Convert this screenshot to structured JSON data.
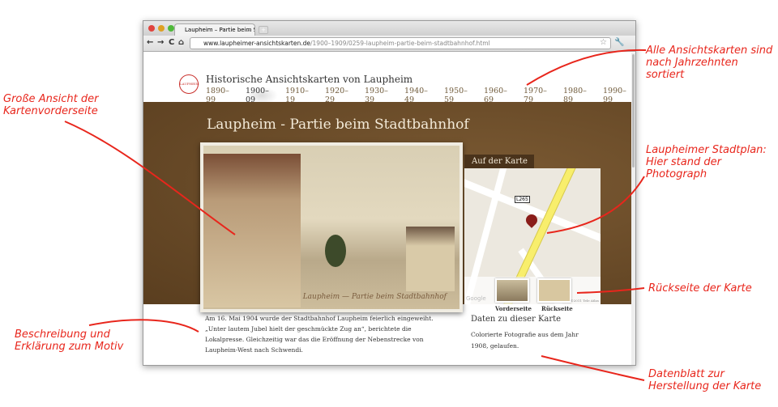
{
  "browser": {
    "tab_title": "Laupheim – Partie beim Stadt",
    "url_domain": "www.laupheimer-ansichtskarten.de",
    "url_path": "/1900–1909/0259-laupheim-partie-beim-stadtbahnhof.html"
  },
  "site": {
    "title": "Historische Ansichtskarten von Laupheim",
    "decades": [
      "1890–99",
      "1900–09",
      "1910–19",
      "1920–29",
      "1930–39",
      "1940–49",
      "1950–59",
      "1960–69",
      "1970–79",
      "1980–89",
      "1990–99"
    ],
    "active_decade": "1900–09"
  },
  "page": {
    "title": "Laupheim - Partie beim Stadtbahnhof",
    "card_caption": "Laupheim — Partie beim Stadtbahnhof",
    "map_tab": "Auf der Karte",
    "map_road": "L265",
    "map_copyright": "©2011 Tele Atlas",
    "map_logo": "Google",
    "thumb_front": "Vorderseite",
    "thumb_back": "Rückseite",
    "description": "Am 16. Mai 1904 wurde der Stadtbahnhof Laupheim feierlich eingeweiht. „Unter lautem Jubel hielt der geschmückte Zug an“, berichtete die Lokalpresse. Gleichzeitig war das die Eröffnung der Nebenstrecke von Laupheim-West nach Schwendi.",
    "data_heading": "Daten zu dieser Karte",
    "data_text": "Colorierte Fotografie aus dem Jahr 1908, gelaufen."
  },
  "annotations": {
    "decades": "Alle Ansichtskarten sind nach Jahrzehnten sortiert",
    "large_view": "Große Ansicht der Kartenvorderseite",
    "map": "Laupheimer Stadtplan: Hier stand der Photograph",
    "back": "Rückseite der Karte",
    "description": "Beschreibung und Erklärung zum Motiv",
    "data": "Datenblatt zur Herstellung der Karte"
  },
  "colors": {
    "annotation": "#e8261c",
    "band": "#6a4b28"
  }
}
